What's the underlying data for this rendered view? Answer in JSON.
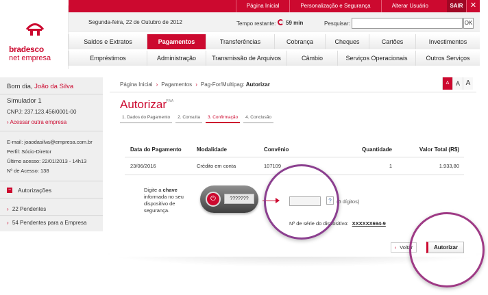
{
  "brand": {
    "name_line1": "bradesco",
    "name_line2": "net empresa",
    "red": "#cc092f",
    "purple": "#8b3f8f"
  },
  "topbar": {
    "links": [
      "Página Inicial",
      "Personalização e Segurança",
      "Alterar Usuário"
    ],
    "sair": "SAIR",
    "close_glyph": "✕"
  },
  "info": {
    "date": "Segunda-feira, 22 de Outubro de 2012",
    "tempo_label": "Tempo restante:",
    "tempo_value": "59 min",
    "pesquisar_label": "Pesquisar:",
    "search_value": "",
    "ok_label": "OK"
  },
  "menu1": [
    "Saldos e Extratos",
    "Pagamentos",
    "Transferências",
    "Cobrança",
    "Cheques",
    "Cartões",
    "Investimentos"
  ],
  "menu1_active": "Pagamentos",
  "menu2": [
    "Empréstimos",
    "Administração",
    "Transmissão de Arquivos",
    "Câmbio",
    "Serviços Operacionais",
    "Outros Serviços"
  ],
  "sidebar": {
    "greeting": "Bom dia,",
    "user_name": "João da Silva",
    "company": "Simulador 1",
    "cnpj": "CNPJ: 237.123.456/0001-00",
    "acessar": "Acessar outra empresa",
    "email": "E-mail: joaodasilva@empresa.com.br",
    "perfil": "Perfil: Sócio-Diretor",
    "ultimo_acesso": "Último acesso: 22/01/2013 - 14h13",
    "num_acesso": "Nº de Acesso: 138",
    "section": "Autorizações",
    "section_glyph": "−",
    "items": [
      "22 Pendentes",
      "54 Pendentes para a Empresa"
    ]
  },
  "content": {
    "breadcrumb": [
      "Página Inicial",
      "Pagamentos",
      "Pag-For/Multipag:",
      "Autorizar"
    ],
    "font_buttons": [
      "A",
      "A",
      "A"
    ],
    "title": "Autorizar",
    "title_sup": "PWA",
    "steps": [
      "1. Dados do Pagamento",
      "2. Consulta",
      "3. Confirmação",
      "4. Conclusão"
    ],
    "active_step": 2,
    "table": {
      "headers": [
        "Data do Pagamento",
        "Modalidade",
        "Convênio",
        "Quantidade",
        "Valor Total (R$)"
      ],
      "row": [
        "23/06/2016",
        "Crédito em conta",
        "107109",
        "1",
        "1.933,80"
      ]
    },
    "digite_prefix": "Digite a",
    "digite_bold": "chave",
    "digite_suffix": "informada no seu dispositivo de segurança.",
    "device_screen": "???????",
    "key_value": "",
    "help_glyph": "?",
    "digits_hint": "(6 dígitos)",
    "serie_label": "Nº de série do dispositivo:",
    "serie_value": "XXXXXX694-9",
    "voltar": "Voltar",
    "voltar_glyph": "‹",
    "autorizar": "Autorizar"
  }
}
